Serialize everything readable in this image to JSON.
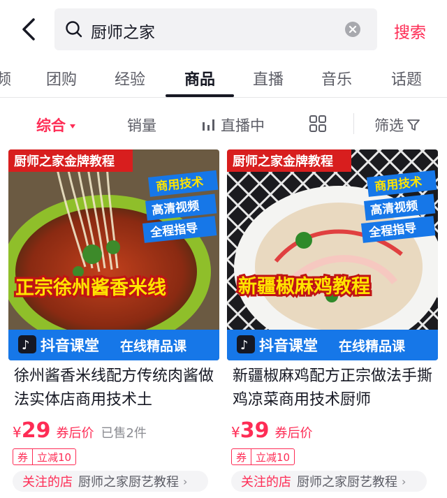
{
  "search": {
    "query": "厨师之家",
    "button_label": "搜索"
  },
  "tabs": [
    {
      "label": "频"
    },
    {
      "label": "团购"
    },
    {
      "label": "经验"
    },
    {
      "label": "商品",
      "active": true
    },
    {
      "label": "直播"
    },
    {
      "label": "音乐"
    },
    {
      "label": "话题"
    }
  ],
  "filters": {
    "comprehensive": "综合",
    "sales": "销量",
    "live": "直播中",
    "filter": "筛选"
  },
  "products": [
    {
      "thumb": {
        "top_banner": "厨师之家金牌教程",
        "badges": [
          "商用技术",
          "高清视频",
          "全程指导"
        ],
        "dish_title": "正宗徐州酱香米线",
        "brand": "抖音课堂",
        "footer": "在线精品课"
      },
      "title": "徐州酱香米线配方传统肉酱做法实体店商用技术土",
      "price_symbol": "¥",
      "price": "29",
      "price_note": "券后价",
      "sold": "已售2件",
      "coupon_tag": "券",
      "coupon_amount": "立减10",
      "shop_prefix": "关注的店",
      "shop_name": "厨师之家厨艺教程"
    },
    {
      "thumb": {
        "top_banner": "厨师之家金牌教程",
        "badges": [
          "商用技术",
          "高清视频",
          "全程指导"
        ],
        "dish_title": "新疆椒麻鸡教程",
        "brand": "抖音课堂",
        "footer": "在线精品课"
      },
      "title": "新疆椒麻鸡配方正宗做法手撕鸡凉菜商用技术厨师",
      "price_symbol": "¥",
      "price": "39",
      "price_note": "券后价",
      "sold": "",
      "coupon_tag": "券",
      "coupon_amount": "立减10",
      "shop_prefix": "关注的店",
      "shop_name": "厨师之家厨艺教程"
    }
  ],
  "colors": {
    "accent": "#fe2c55",
    "banner_red": "#d81e1e",
    "banner_blue": "#1677e8"
  }
}
